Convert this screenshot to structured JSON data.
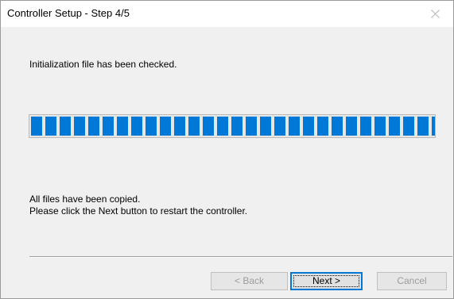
{
  "window": {
    "title": "Controller Setup - Step 4/5",
    "close_icon": "close-icon"
  },
  "content": {
    "status_text": "Initialization file has been checked.",
    "progress": {
      "percent": 100,
      "color": "#0078d7"
    },
    "message_line1": "All files have been copied.",
    "message_line2": "Please click the Next button to restart the controller."
  },
  "buttons": {
    "back_label": "< Back",
    "next_label": "Next >",
    "cancel_label": "Cancel"
  }
}
